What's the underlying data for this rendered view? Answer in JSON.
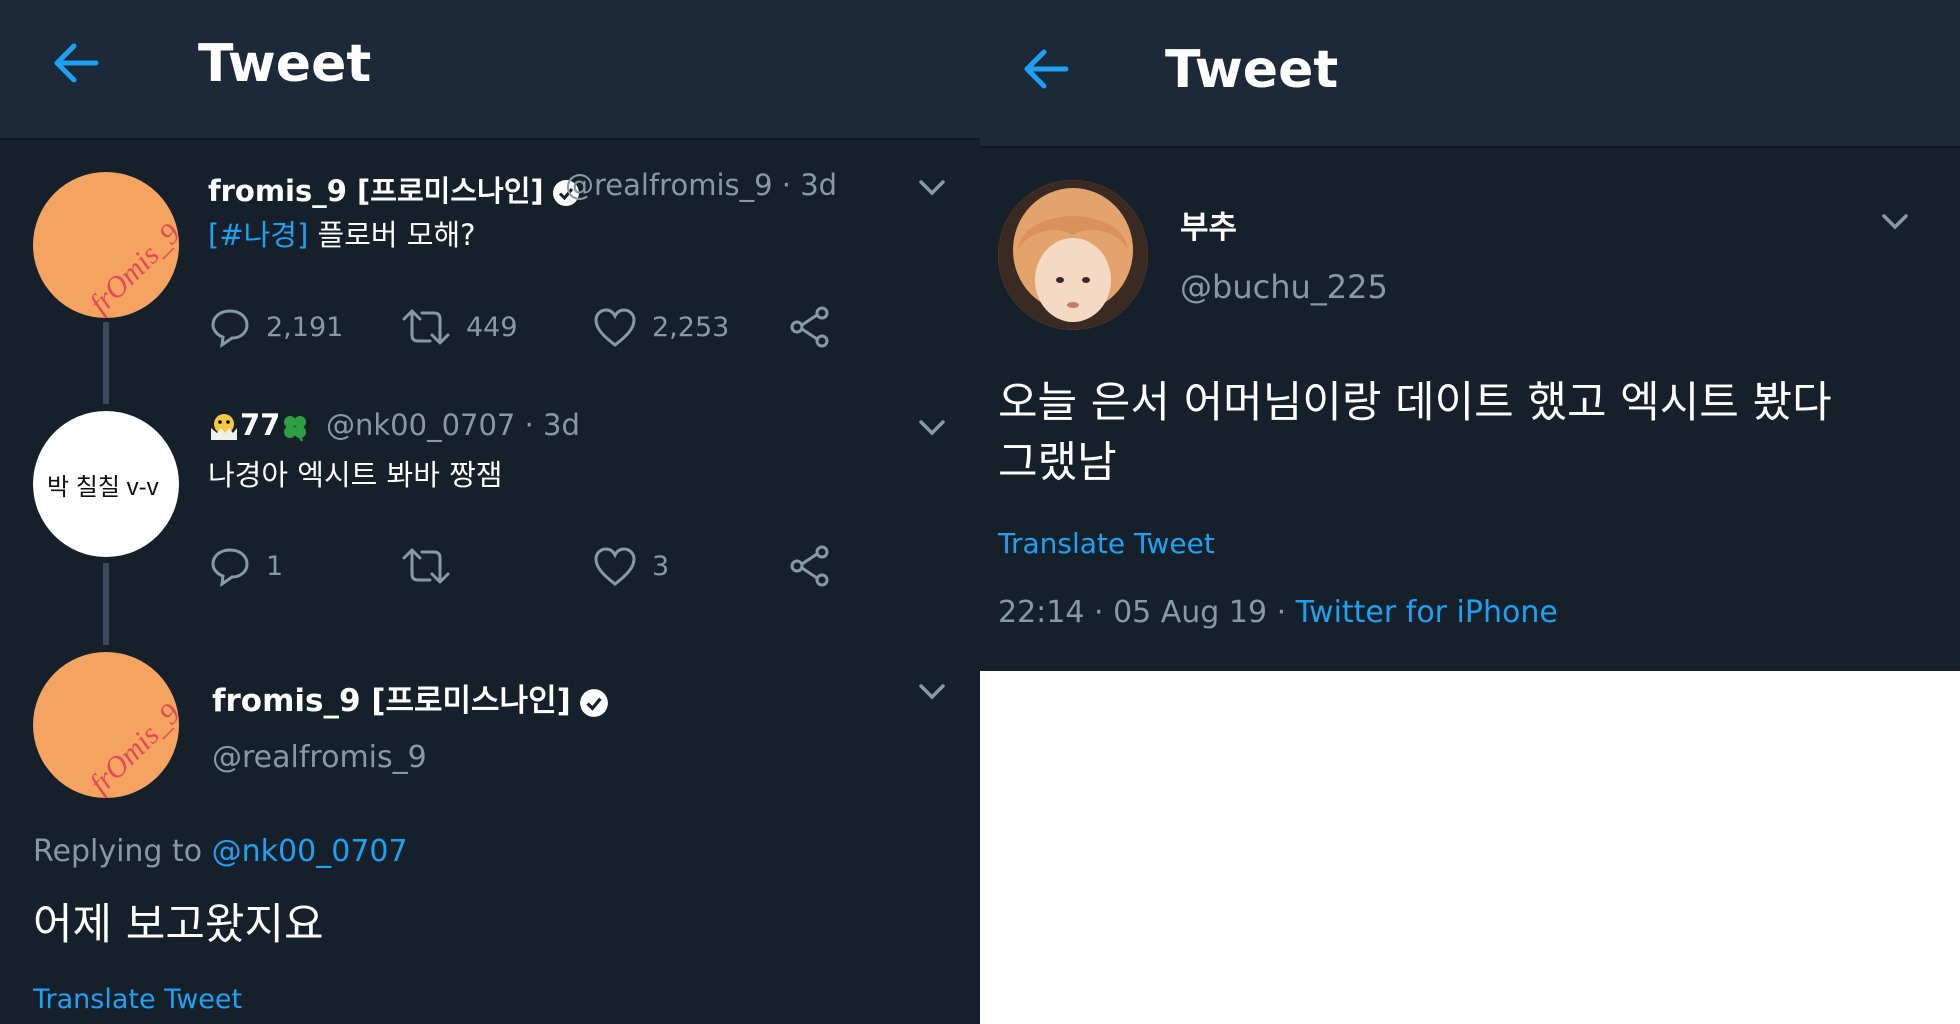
{
  "left": {
    "header": {
      "title": "Tweet"
    },
    "tweet1": {
      "name": "fromis_9 [프로미스나인]",
      "handle": "@realfromis_9 · 3d",
      "hashtag": "[#나경]",
      "text": " 플로버 모해?",
      "replies": "2,191",
      "retweets": "449",
      "likes": "2,253",
      "avatar_text": "frOmis_9"
    },
    "tweet2": {
      "name": "77",
      "handle": "@nk00_0707 · 3d",
      "text": "나경아 엑시트 봐바 짱잼",
      "replies": "1",
      "retweets": "",
      "likes": "3",
      "avatar_text": "박 칠칠 v-v"
    },
    "tweet3": {
      "name": "fromis_9 [프로미스나인]",
      "handle": "@realfromis_9",
      "replying_prefix": "Replying to ",
      "replying_to": "@nk00_0707",
      "text": "어제 보고왔지요",
      "translate": "Translate Tweet",
      "avatar_text": "frOmis_9"
    }
  },
  "right": {
    "header": {
      "title": "Tweet"
    },
    "tweet": {
      "name": "부추",
      "handle": "@buchu_225",
      "text_line1": "오늘 은서 어머님이랑 데이트 했고 엑시트 봤다",
      "text_line2": "그랬남",
      "translate": "Translate Tweet",
      "meta": "22:14 · 05 Aug 19 · ",
      "source": "Twitter for iPhone"
    }
  },
  "colors": {
    "background": "#15202b",
    "header": "#1c2938",
    "accent": "#1da1f2",
    "muted": "#8899a6",
    "avatar_orange": "#f4a460"
  },
  "icons": [
    "back-arrow-icon",
    "chevron-down-icon",
    "reply-icon",
    "retweet-icon",
    "like-icon",
    "share-icon",
    "verified-icon"
  ]
}
